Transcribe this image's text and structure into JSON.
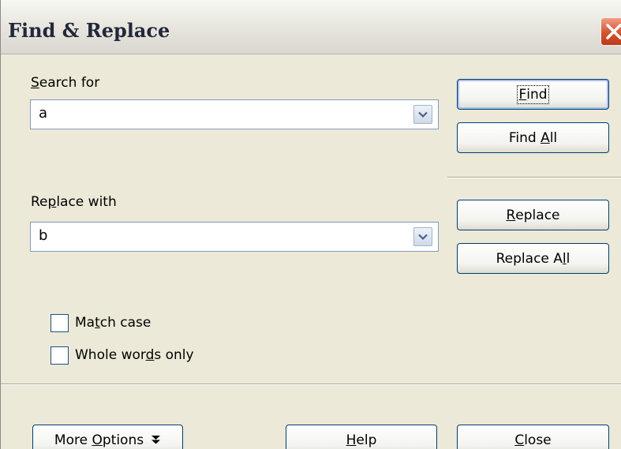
{
  "window": {
    "title": "Find & Replace"
  },
  "search": {
    "label_pre": "",
    "label_key": "S",
    "label_post": "earch for",
    "value": "a"
  },
  "replace": {
    "label_pre": "Re",
    "label_key": "p",
    "label_post": "lace with",
    "value": "b"
  },
  "buttons": {
    "find": {
      "pre": "",
      "key": "F",
      "post": "ind"
    },
    "find_all": {
      "pre": "Find ",
      "key": "A",
      "post": "ll"
    },
    "replace": {
      "pre": "",
      "key": "R",
      "post": "eplace"
    },
    "replace_all": {
      "pre": "Replace A",
      "key": "l",
      "post": "l"
    },
    "more_options": {
      "pre": "More ",
      "key": "O",
      "post": "ptions"
    },
    "help": {
      "pre": "",
      "key": "H",
      "post": "elp"
    },
    "close": {
      "pre": "",
      "key": "C",
      "post": "lose"
    }
  },
  "options": {
    "match_case": {
      "pre": "Ma",
      "key": "t",
      "post": "ch case",
      "checked": false
    },
    "whole_words": {
      "pre": "Whole wor",
      "key": "d",
      "post": "s only",
      "checked": false
    }
  }
}
